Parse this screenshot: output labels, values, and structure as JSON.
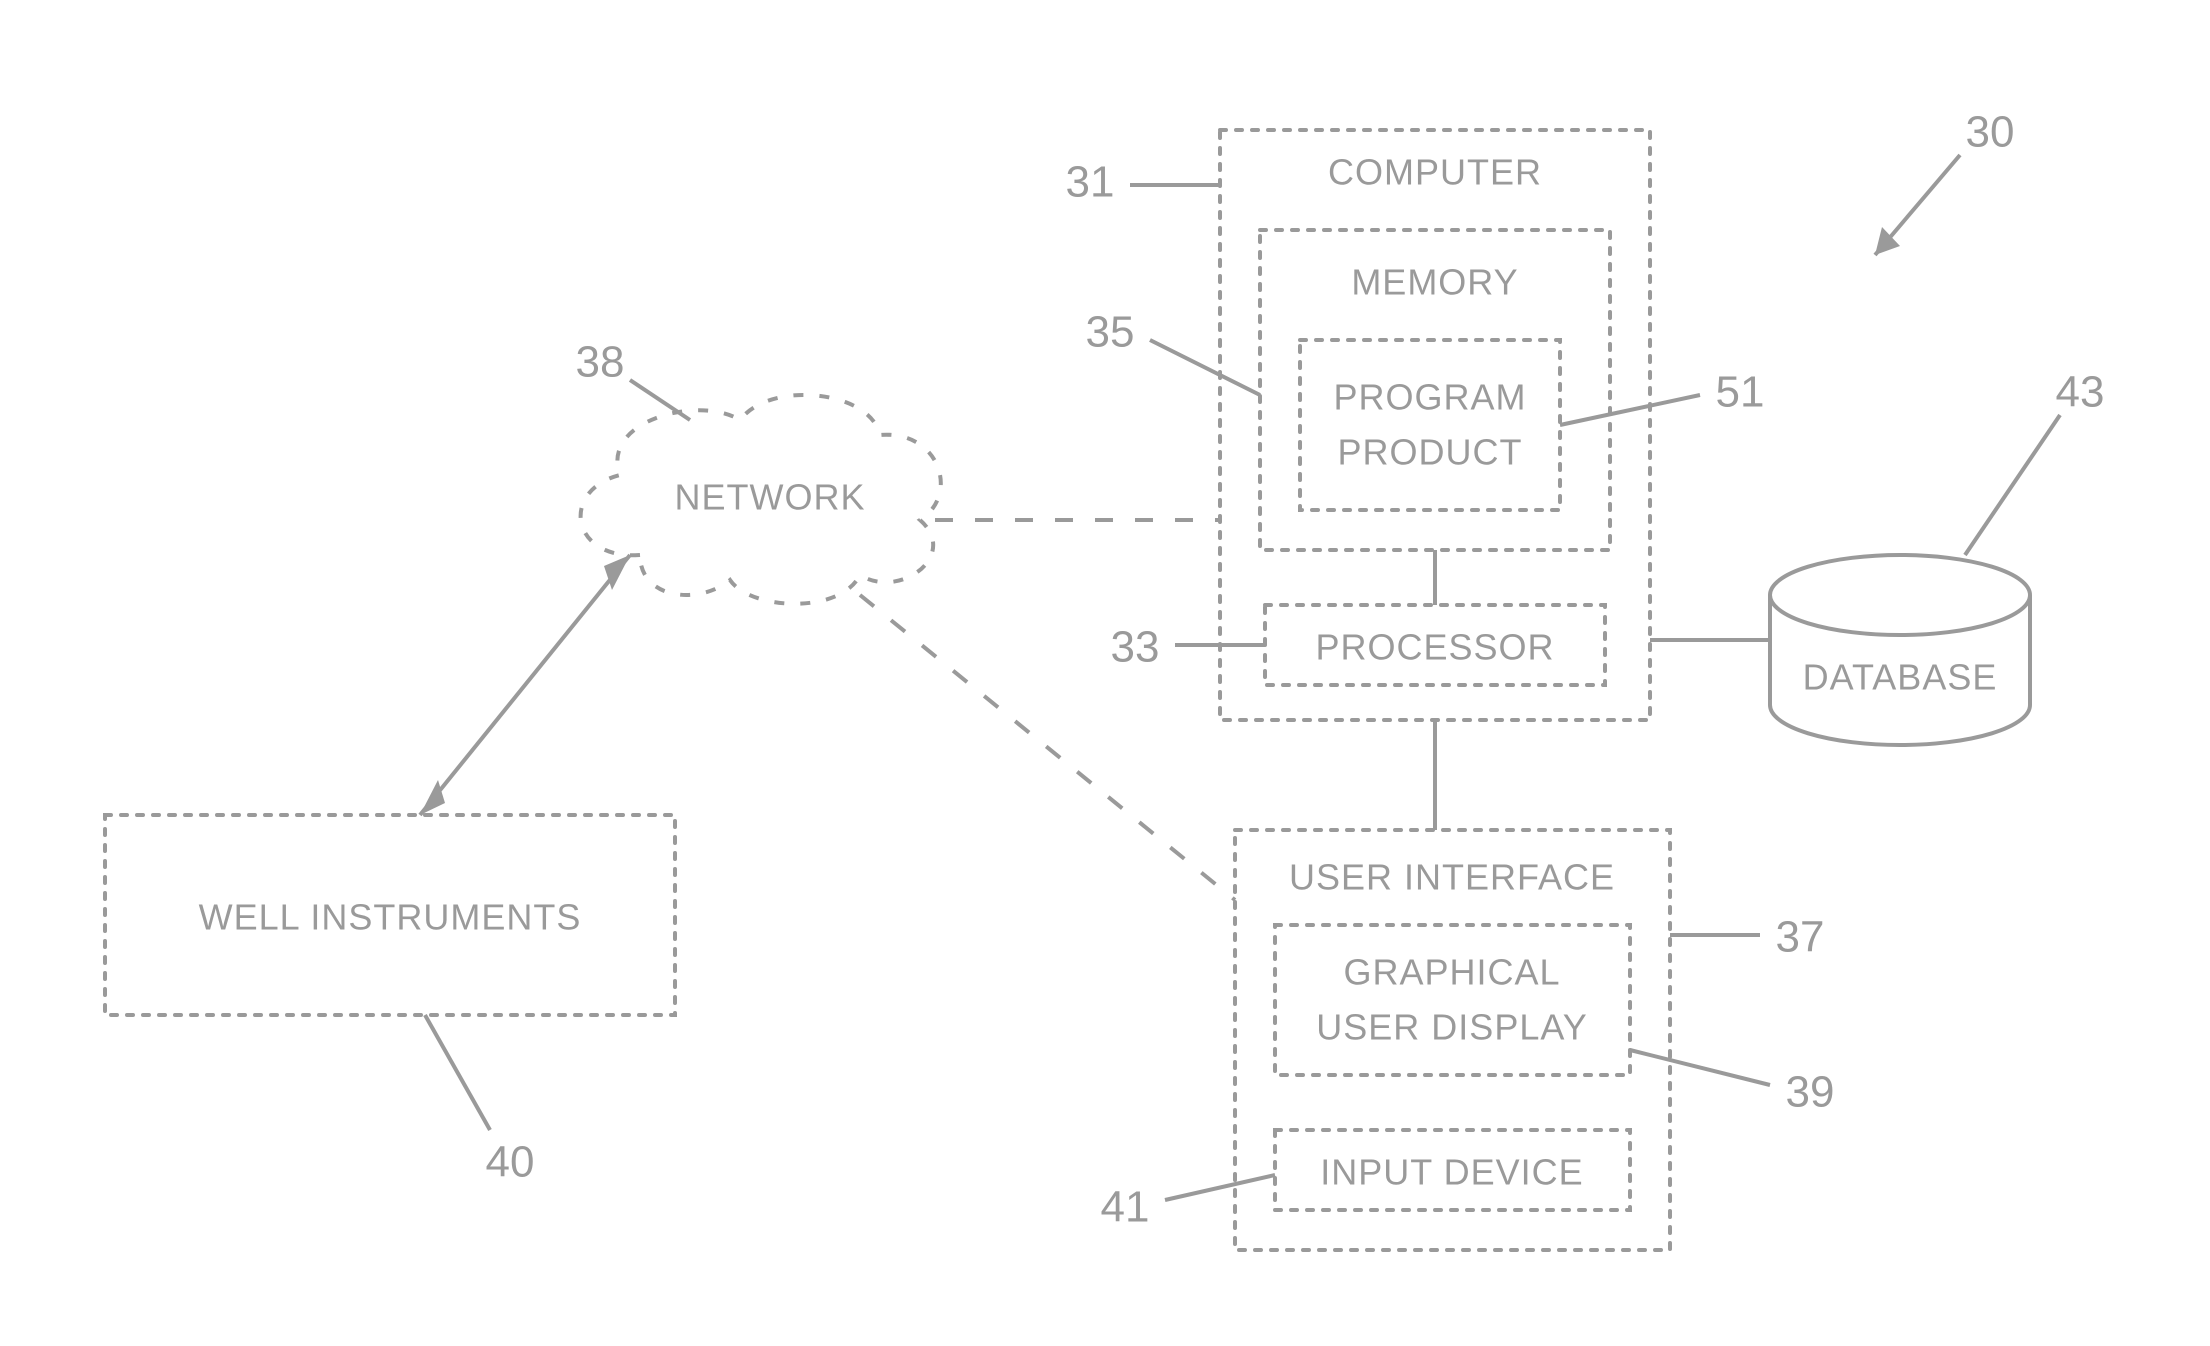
{
  "refs": {
    "system": "30",
    "computer": "31",
    "processor": "33",
    "memory": "35",
    "ui": "37",
    "network": "38",
    "gud": "39",
    "well": "40",
    "input": "41",
    "db": "43",
    "program": "51"
  },
  "labels": {
    "computer": "COMPUTER",
    "memory": "MEMORY",
    "program1": "PROGRAM",
    "program2": "PRODUCT",
    "processor": "PROCESSOR",
    "ui": "USER INTERFACE",
    "gud1": "GRAPHICAL",
    "gud2": "USER DISPLAY",
    "input": "INPUT DEVICE",
    "db": "DATABASE",
    "network": "NETWORK",
    "well": "WELL INSTRUMENTS"
  }
}
